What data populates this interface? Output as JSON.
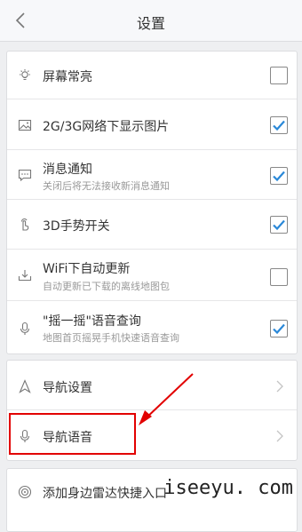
{
  "header": {
    "title": "设置"
  },
  "settings": [
    {
      "label": "屏幕常亮",
      "sub": "",
      "checked": false,
      "icon": "bulb-icon"
    },
    {
      "label": "2G/3G网络下显示图片",
      "sub": "",
      "checked": true,
      "icon": "image-icon"
    },
    {
      "label": "消息通知",
      "sub": "关闭后将无法接收新消息通知",
      "checked": true,
      "icon": "chat-icon"
    },
    {
      "label": "3D手势开关",
      "sub": "",
      "checked": true,
      "icon": "hand-gesture-icon"
    },
    {
      "label": "WiFi下自动更新",
      "sub": "自动更新已下载的离线地图包",
      "checked": false,
      "icon": "download-tray-icon"
    },
    {
      "label": "\"摇一摇\"语音查询",
      "sub": "地图首页摇晃手机快速语音查询",
      "checked": true,
      "icon": "microphone-icon"
    }
  ],
  "navigation": [
    {
      "label": "导航设置",
      "icon": "navigation-arrow-icon"
    },
    {
      "label": "导航语音",
      "icon": "microphone-icon"
    }
  ],
  "extra": {
    "label": "添加身边雷达快捷入口",
    "icon": "radar-icon"
  },
  "watermark": "iseeyu. com",
  "colors": {
    "check": "#2a88d8",
    "annotation": "#e20000"
  }
}
